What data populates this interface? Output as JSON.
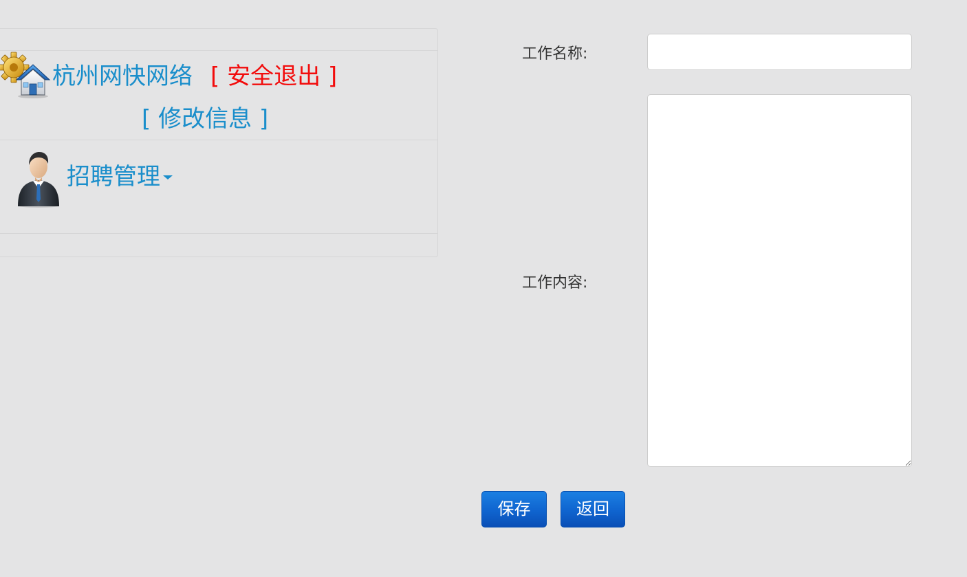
{
  "sidebar": {
    "site_name": "杭州网快网络",
    "logout_label": "[ 安全退出 ]",
    "edit_info_label": "[ 修改信息 ]",
    "menu": {
      "label": "招聘管理"
    }
  },
  "form": {
    "name_label": "工作名称:",
    "name_value": "",
    "content_label": "工作内容:",
    "content_value": "",
    "save_label": "保存",
    "back_label": "返回"
  },
  "icons": {
    "site": "gear-house-icon",
    "user": "businessman-avatar-icon",
    "menu_toggle": "caret-down-icon"
  },
  "colors": {
    "background": "#e4e4e5",
    "link": "#1a8ecb",
    "logout": "#f20c0c",
    "button": "#0f64cf",
    "label": "#333333"
  }
}
